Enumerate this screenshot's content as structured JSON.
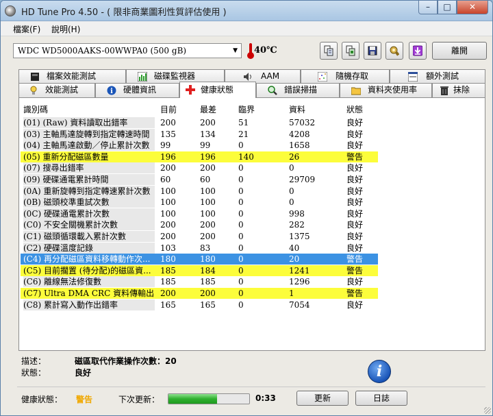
{
  "window": {
    "title": "HD Tune Pro 4.50 - ( 限非商業圖利性質評估使用 )",
    "controls": {
      "minimize": "–",
      "maximize": "□",
      "close": "✕"
    }
  },
  "menu": {
    "items": [
      "檔案(F)",
      "說明(H)"
    ]
  },
  "toolbar": {
    "drive": "WDC WD5000AAKS-00WWPA0   (500 gB)",
    "temperature": "40℃",
    "exit_label": "離開",
    "icons": [
      "copy-info-icon",
      "copy-screenshot-icon",
      "save-icon",
      "options-icon",
      "download-icon"
    ]
  },
  "tabs": {
    "row1": [
      {
        "label": "檔案效能測試",
        "icon": "file-benchmark-icon"
      },
      {
        "label": "磁碟監視器",
        "icon": "disk-monitor-icon"
      },
      {
        "label": "AAM",
        "icon": "speaker-icon"
      },
      {
        "label": "隨機存取",
        "icon": "random-access-icon"
      },
      {
        "label": "額外測試",
        "icon": "extra-tests-icon"
      }
    ],
    "row2": [
      {
        "label": "效能測試",
        "icon": "benchmark-icon"
      },
      {
        "label": "硬體資訊",
        "icon": "info-icon"
      },
      {
        "label": "健康狀態",
        "icon": "health-cross-icon"
      },
      {
        "label": "錯誤掃描",
        "icon": "magnifier-icon"
      },
      {
        "label": "資料夾使用率",
        "icon": "folder-icon"
      },
      {
        "label": "抹除",
        "icon": "trash-icon"
      }
    ]
  },
  "table": {
    "headers": [
      "識別碼",
      "目前",
      "最差",
      "臨界",
      "資料",
      "狀態"
    ],
    "rows": [
      {
        "id": "(01) (Raw) 資料讀取出錯率",
        "cur": "200",
        "worst": "200",
        "thr": "51",
        "data": "57032",
        "status": "良好",
        "style": "norm"
      },
      {
        "id": "(03) 主軸馬達旋轉到指定轉速時間",
        "cur": "135",
        "worst": "134",
        "thr": "21",
        "data": "4208",
        "status": "良好",
        "style": "norm"
      },
      {
        "id": "(04) 主軸馬達啟動／停止累計次數",
        "cur": "99",
        "worst": "99",
        "thr": "0",
        "data": "1658",
        "status": "良好",
        "style": "norm"
      },
      {
        "id": "(05) 重新分配磁區數量",
        "cur": "196",
        "worst": "196",
        "thr": "140",
        "data": "26",
        "status": "警告",
        "style": "warn"
      },
      {
        "id": "(07) 搜尋出錯率",
        "cur": "200",
        "worst": "200",
        "thr": "0",
        "data": "0",
        "status": "良好",
        "style": "norm"
      },
      {
        "id": "(09) 硬碟通電累計時間",
        "cur": "60",
        "worst": "60",
        "thr": "0",
        "data": "29709",
        "status": "良好",
        "style": "norm"
      },
      {
        "id": "(0A) 重新旋轉到指定轉速累計次數",
        "cur": "100",
        "worst": "100",
        "thr": "0",
        "data": "0",
        "status": "良好",
        "style": "norm"
      },
      {
        "id": "(0B) 磁頭校準重試次數",
        "cur": "100",
        "worst": "100",
        "thr": "0",
        "data": "0",
        "status": "良好",
        "style": "norm"
      },
      {
        "id": "(0C) 硬碟通電累計次數",
        "cur": "100",
        "worst": "100",
        "thr": "0",
        "data": "998",
        "status": "良好",
        "style": "norm"
      },
      {
        "id": "(C0) 不安全關機累計次數",
        "cur": "200",
        "worst": "200",
        "thr": "0",
        "data": "282",
        "status": "良好",
        "style": "norm"
      },
      {
        "id": "(C1) 磁頭循環載入累計次數",
        "cur": "200",
        "worst": "200",
        "thr": "0",
        "data": "1375",
        "status": "良好",
        "style": "norm"
      },
      {
        "id": "(C2) 硬碟溫度記錄",
        "cur": "103",
        "worst": "83",
        "thr": "0",
        "data": "40",
        "status": "良好",
        "style": "norm"
      },
      {
        "id": "(C4) 再分配磁區資料移轉動作次...",
        "cur": "180",
        "worst": "180",
        "thr": "0",
        "data": "20",
        "status": "警告",
        "style": "sel"
      },
      {
        "id": "(C5) 目前擱置 (待分配)的磁區資...",
        "cur": "185",
        "worst": "184",
        "thr": "0",
        "data": "1241",
        "status": "警告",
        "style": "warn"
      },
      {
        "id": "(C6) 離線無法修復數",
        "cur": "185",
        "worst": "185",
        "thr": "0",
        "data": "1296",
        "status": "良好",
        "style": "norm"
      },
      {
        "id": "(C7) Ultra DMA CRC 資料傳輸出...",
        "cur": "200",
        "worst": "200",
        "thr": "0",
        "data": "1",
        "status": "警告",
        "style": "warn"
      },
      {
        "id": "(C8) 累計寫入動作出錯率",
        "cur": "165",
        "worst": "165",
        "thr": "0",
        "data": "7054",
        "status": "良好",
        "style": "norm"
      }
    ]
  },
  "info": {
    "desc_label": "描述：",
    "desc_value": "磁區取代作業操作次數：20",
    "status_label": "狀態：",
    "status_value": "良好"
  },
  "statusbar": {
    "health_label": "健康狀態：",
    "health_value": "警告",
    "health_color": "#f0a800",
    "next_update_label": "下次更新：",
    "progress_fraction": 0.6,
    "countdown": "0:33",
    "refresh_label": "更新",
    "log_label": "日誌"
  }
}
